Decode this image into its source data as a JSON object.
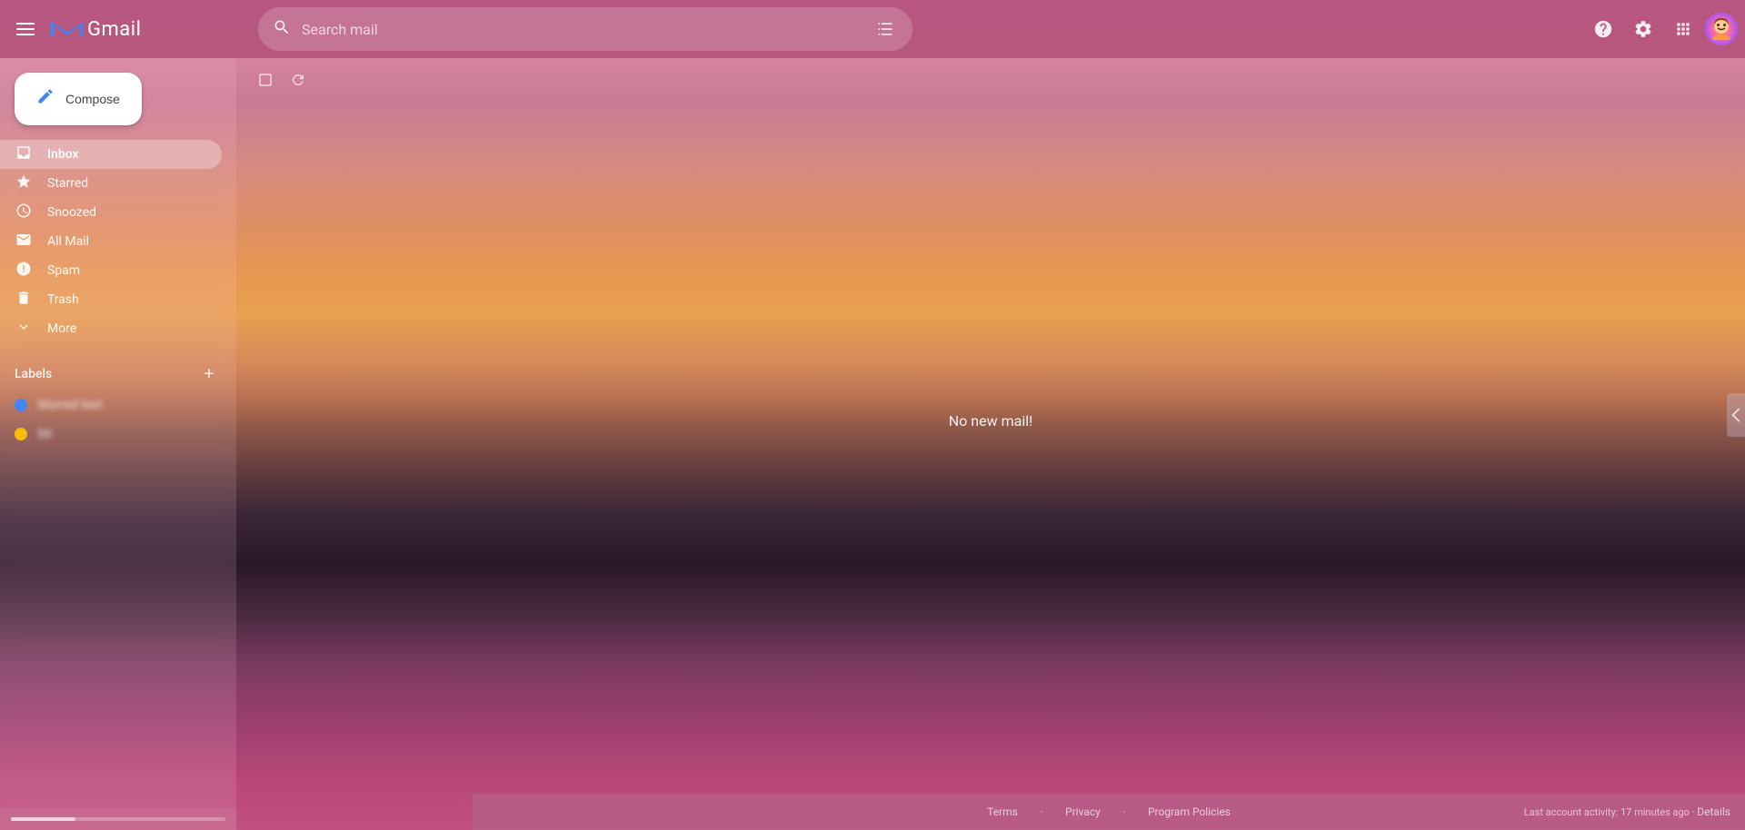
{
  "app": {
    "name": "Gmail",
    "title": "Gmail"
  },
  "header": {
    "menu_label": "Main menu",
    "search_placeholder": "Search mail",
    "search_options_label": "Search options",
    "help_label": "Help",
    "settings_label": "Settings",
    "apps_label": "Google apps",
    "account_label": "Google Account"
  },
  "sidebar": {
    "compose_label": "Compose",
    "nav_items": [
      {
        "id": "inbox",
        "label": "Inbox",
        "icon": "inbox",
        "active": true
      },
      {
        "id": "starred",
        "label": "Starred",
        "icon": "star"
      },
      {
        "id": "snoozed",
        "label": "Snoozed",
        "icon": "clock"
      },
      {
        "id": "all-mail",
        "label": "All Mail",
        "icon": "mail"
      },
      {
        "id": "spam",
        "label": "Spam",
        "icon": "warning"
      },
      {
        "id": "trash",
        "label": "Trash",
        "icon": "trash"
      },
      {
        "id": "more",
        "label": "More",
        "icon": "chevron-down"
      }
    ],
    "labels_section": {
      "title": "Labels",
      "add_label": "+"
    },
    "labels": [
      {
        "id": "label-1",
        "color": "#4285f4",
        "text": "blurred"
      },
      {
        "id": "label-2",
        "color": "#fbbc05",
        "text": "blurred"
      }
    ]
  },
  "main": {
    "no_mail_message": "No new mail!",
    "toolbar": {
      "select_all": "Select all",
      "refresh": "Refresh"
    }
  },
  "footer": {
    "links": [
      "Terms",
      "Privacy",
      "Program Policies"
    ],
    "activity": "Last account activity: 17 minutes ago",
    "details_label": "Details"
  },
  "storage": {
    "used_percent": 30
  },
  "colors": {
    "accent": "#d4829e",
    "header_bg": "rgba(180,80,120,0.85)",
    "sidebar_active": "rgba(255,255,255,0.3)"
  }
}
